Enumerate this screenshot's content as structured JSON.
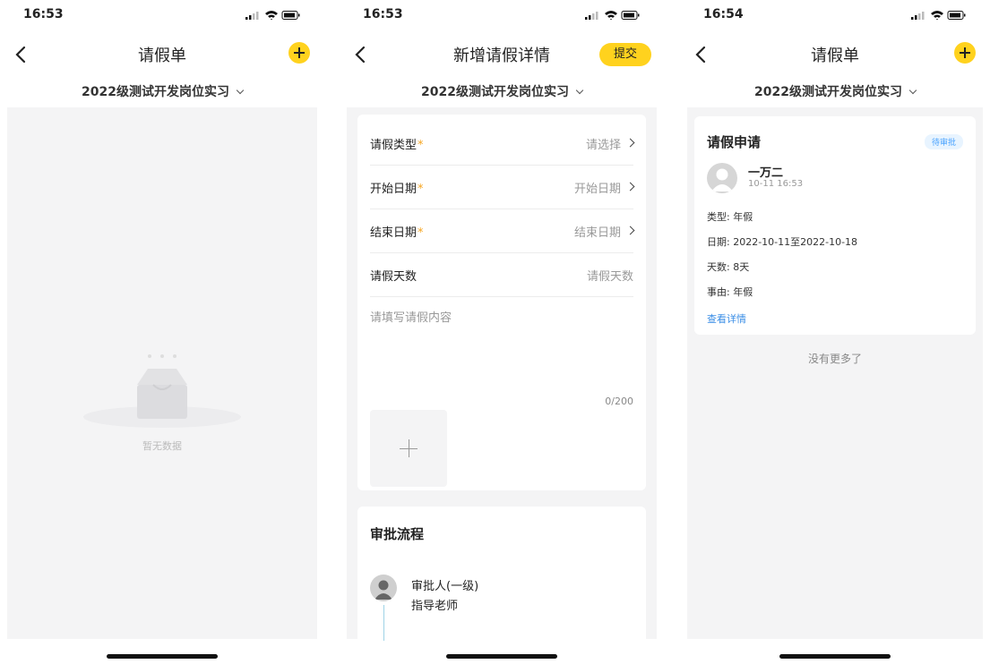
{
  "screens": [
    {
      "time": "16:53",
      "title": "请假单",
      "subtitle": "2022级测试开发岗位实习",
      "empty_text": "暂无数据"
    },
    {
      "time": "16:53",
      "title": "新增请假详情",
      "submit_label": "提交",
      "subtitle": "2022级测试开发岗位实习",
      "form": {
        "rows": [
          {
            "label": "请假类型",
            "required": "*",
            "value": "请选择"
          },
          {
            "label": "开始日期",
            "required": "*",
            "value": "开始日期"
          },
          {
            "label": "结束日期",
            "required": "*",
            "value": "结束日期"
          },
          {
            "label": "请假天数",
            "required": "",
            "value": "请假天数"
          }
        ],
        "reason_placeholder": "请填写请假内容",
        "counter": "0/200"
      },
      "approval": {
        "title": "审批流程",
        "role": "审批人(一级)",
        "name": "指导老师"
      }
    },
    {
      "time": "16:54",
      "title": "请假单",
      "subtitle": "2022级测试开发岗位实习",
      "card": {
        "title": "请假申请",
        "status": "待审批",
        "user": "一万二",
        "submitted": "10-11 16:53",
        "type_line": "类型: 年假",
        "date_line": "日期: 2022-10-11至2022-10-18",
        "days_line": "天数: 8天",
        "reason_line": "事由: 年假",
        "detail_link": "查看详情"
      },
      "no_more": "没有更多了"
    }
  ]
}
